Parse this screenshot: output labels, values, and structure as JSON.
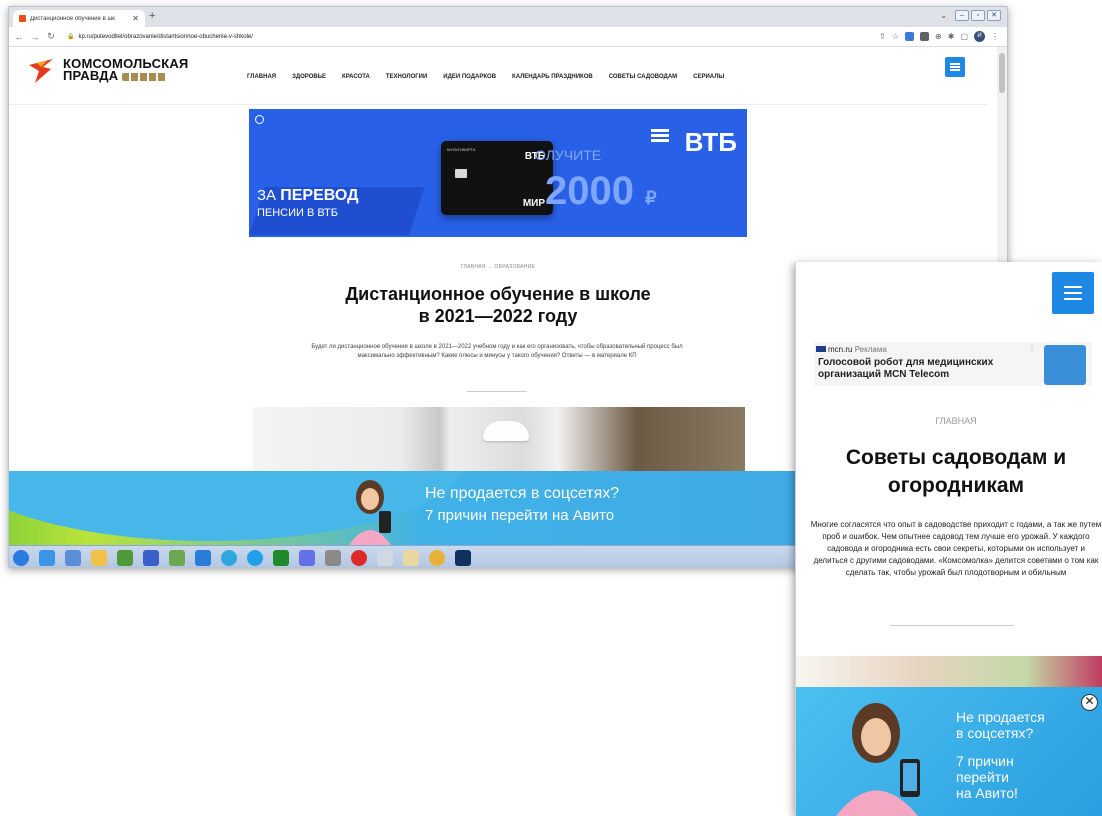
{
  "browser": {
    "tab_title": "Дистанционное обучение в шк",
    "url": "kp.ru/putevoditel/obrazovanie/distantsionnoe-obuchenie-v-shkole/",
    "profile_initial": "И"
  },
  "site": {
    "logo_line1": "КОМСОМОЛЬСКАЯ",
    "logo_line2": "ПРАВДА",
    "nav": [
      "ГЛАВНАЯ",
      "ЗДОРОВЬЕ",
      "КРАСОТА",
      "ТЕХНОЛОГИИ",
      "ИДЕИ ПОДАРКОВ",
      "КАЛЕНДАРЬ ПРАЗДНИКОВ",
      "СОВЕТЫ САДОВОДАМ",
      "СЕРИАЛЫ"
    ]
  },
  "vtb_ad": {
    "line1_prefix": "ЗА",
    "line1_bold": "ПЕРЕВОД",
    "line2": "ПЕНСИИ В ВТБ",
    "brand": "ВТБ",
    "card_label": "МУЛЬТИКАРТА",
    "card_brand": "ВТБ",
    "card_system": "МИР",
    "poluchite": "ОЛУЧИТЕ",
    "amount": "2000",
    "currency": "₽"
  },
  "article": {
    "breadcrumb": "ГЛАВНАЯ  →  ОБРАЗОВАНИЕ",
    "title_line1": "Дистанционное обучение в школе",
    "title_line2": "в 2021—2022 году",
    "lead": "Будет ли дистанционное обучение в школе в 2021—2022 учебном году и как его организовать, чтобы образовательный процесс был максимально эффективным? Какие плюсы и минусы у такого обучения? Ответы — в материале КП"
  },
  "avito_ad": {
    "headline": "Не продается в соцсетях?",
    "subline": "7 причин перейти на Авито"
  },
  "mobile": {
    "ad_source": "mcn.ru",
    "ad_label": "Реклама",
    "ad_title": "Голосовой робот для медицинских организаций MCN Telecom",
    "breadcrumb": "ГЛАВНАЯ",
    "title": "Советы садоводам и огородникам",
    "lead": "Многие согласятся что опыт в садоводстве приходит с годами, а так же путем проб и ошибок. Чем опытнее садовод тем лучше его урожай. У каждого садовода и огородника есть свои секреты, которыми он использует и делиться с другими садоводами. «Комсомолка» делится советами о том как сделать так, чтобы урожай был плодотворным и обильным",
    "avito_line1": "Не продается\nв соцсетях?",
    "avito_line2": "7 причин\nперейти\nна Авито!"
  },
  "colors": {
    "accent": "#1e88e5",
    "vtb": "#2860e8",
    "avito_blue": "#40b2e8",
    "avito_green": "#9ad334"
  }
}
